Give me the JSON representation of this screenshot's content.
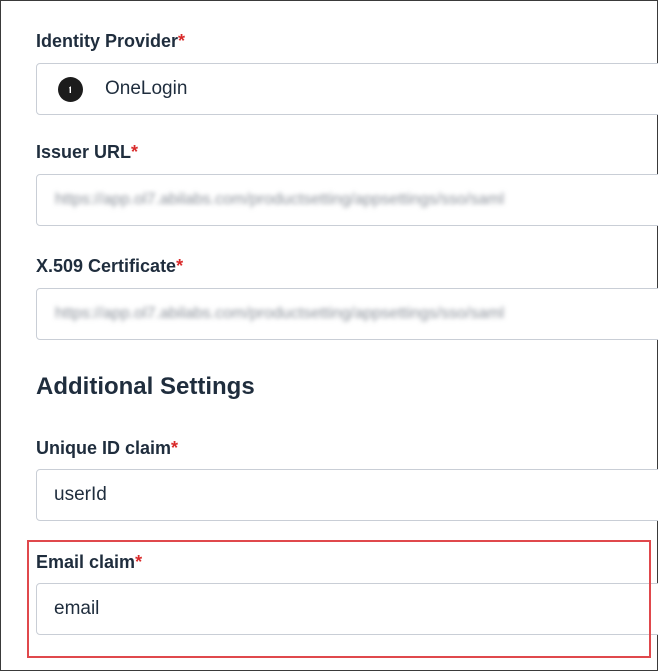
{
  "required_marker": "*",
  "identity_provider": {
    "label": "Identity Provider",
    "value": "OneLogin",
    "icon": "onelogin-logo-icon"
  },
  "issuer_url": {
    "label": "Issuer URL",
    "value": "https://app.ol7.abilabs.com/productsetting/appsettings/sso/saml"
  },
  "x509_certificate": {
    "label": "X.509 Certificate",
    "value": "https://app.ol7.abilabs.com/productsetting/appsettings/sso/saml"
  },
  "additional_settings": {
    "title": "Additional Settings",
    "unique_id_claim": {
      "label": "Unique ID claim",
      "value": "userId"
    },
    "email_claim": {
      "label": "Email claim",
      "value": "email"
    }
  },
  "colors": {
    "required": "#d92a2a",
    "highlight_border": "#e0484c",
    "text": "#1f2d3d",
    "field_border": "#c9ced6"
  }
}
